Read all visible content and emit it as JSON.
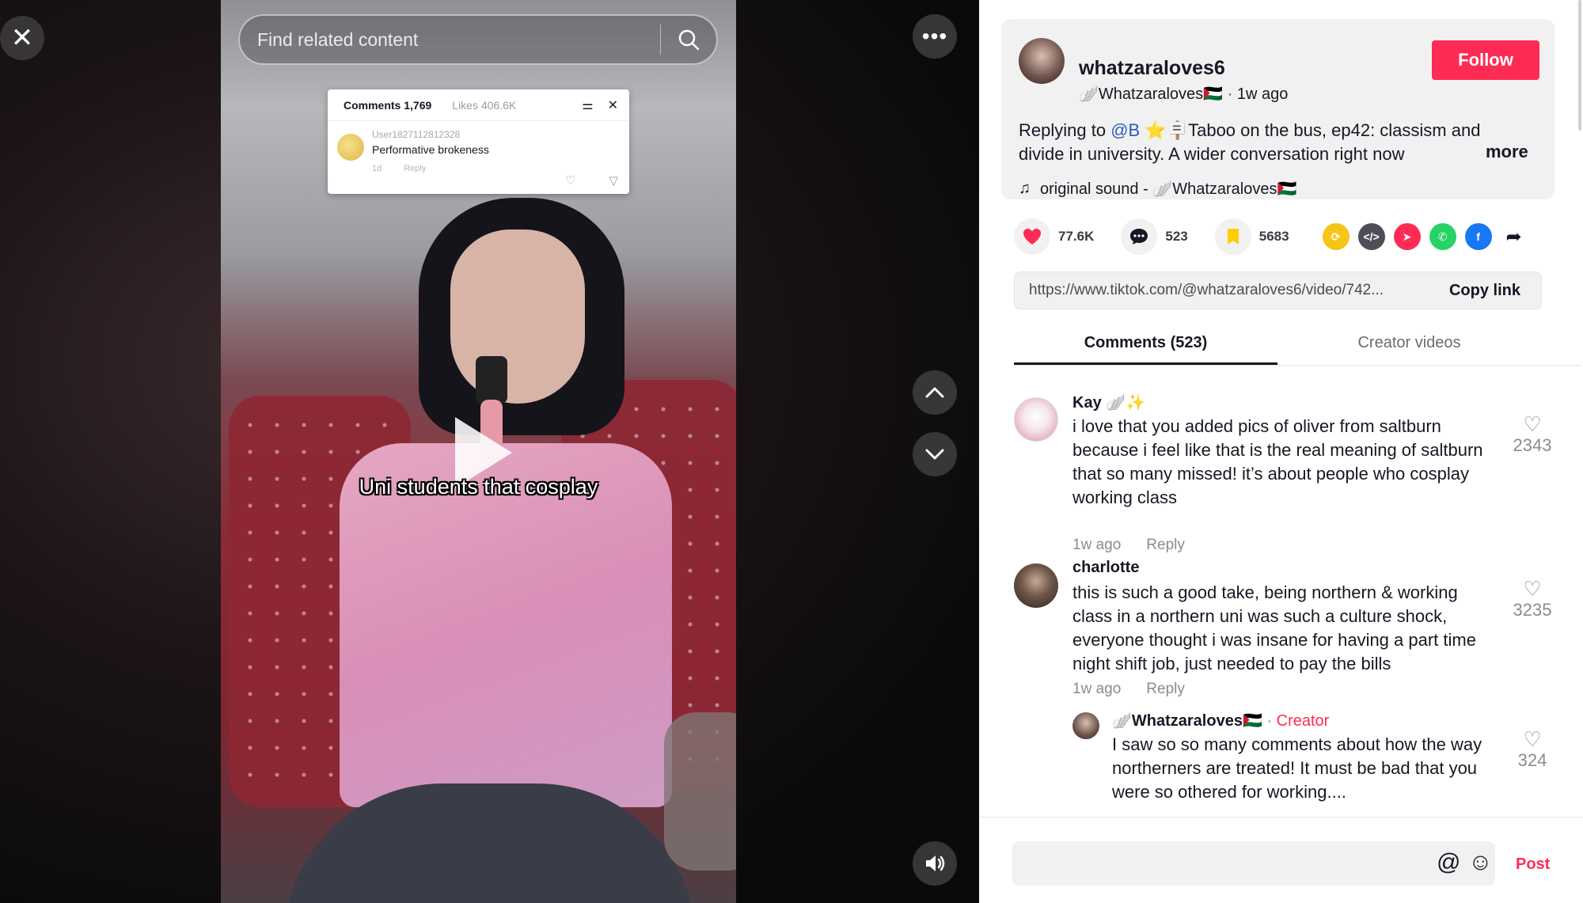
{
  "player": {
    "search_placeholder": "Find related content",
    "caption": "Uni students that cosplay",
    "overlay": {
      "tab_comments": "Comments 1,769",
      "tab_likes": "Likes 406.6K",
      "user": "User1827112812328",
      "text": "Performative brokeness",
      "time": "1d",
      "reply": "Reply"
    }
  },
  "post": {
    "username": "whatzaraloves6",
    "display_name": "🪽Whatzaraloves🇵🇸",
    "time_ago": "1w ago",
    "follow_label": "Follow",
    "desc_prefix": "Replying to ",
    "desc_mention": "@B ⭐️🪧",
    "desc_rest": "Taboo on the bus, ep42: classism and divide in university. A wider conversation right now",
    "more_label": "more",
    "sound": "original sound - 🪽Whatzaraloves🇵🇸"
  },
  "actions": {
    "likes": "77.6K",
    "comments": "523",
    "saves": "5683"
  },
  "share_icons": [
    "repost-icon",
    "embed-icon",
    "send-icon",
    "whatsapp-icon",
    "facebook-icon",
    "share-arrow-icon"
  ],
  "link": {
    "url": "https://www.tiktok.com/@whatzaraloves6/video/742...",
    "copy_label": "Copy link"
  },
  "tabs": {
    "comments": "Comments (523)",
    "creator_videos": "Creator videos"
  },
  "comments": [
    {
      "name": "Kay 🪽✨",
      "text": "i love that you added pics of oliver from saltburn because i feel like that is the real meaning of saltburn that so many missed! it’s about people who cosplay working class",
      "time": "1w ago",
      "reply": "Reply",
      "likes": "2343"
    },
    {
      "name": "charlotte",
      "text": "this is such a good take, being northern & working class in a northern uni was such a culture shock, everyone thought i was insane for having a part time night shift job, just needed to pay the bills",
      "time": "1w ago",
      "reply": "Reply",
      "likes": "3235"
    }
  ],
  "reply": {
    "name": "🪽Whatzaraloves🇵🇸",
    "creator_label": "Creator",
    "text": "I saw so so many comments about how the way northerners are treated! It must be bad that you were so othered for working....",
    "likes": "324"
  },
  "composer": {
    "post_label": "Post"
  },
  "colors": {
    "accent": "#fe2c55",
    "mention": "#2b5db9"
  }
}
